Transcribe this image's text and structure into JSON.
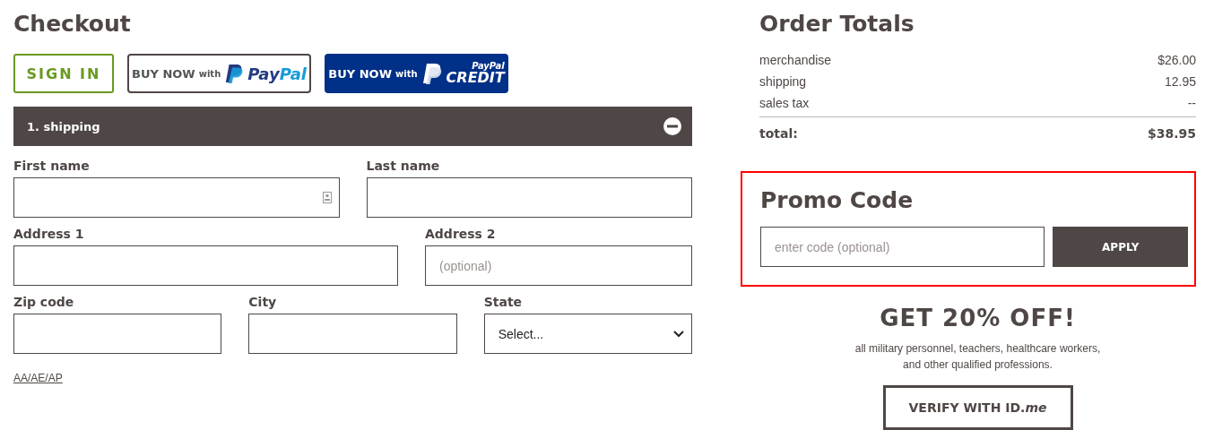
{
  "page_title": "Checkout",
  "sign_in_button": "SIGN IN",
  "paypal_button": {
    "label": "BUY NOW",
    "small": "with",
    "brand_a": "Pay",
    "brand_b": "Pal"
  },
  "paypal_credit_button": {
    "label": "BUY NOW",
    "small": "with",
    "brand": "PayPal",
    "product": "CREDIT"
  },
  "section": {
    "title": "1. shipping",
    "expanded": true
  },
  "form_rows": [
    [
      {
        "label": "First name",
        "kind": "text",
        "contact_icon": true
      },
      {
        "label": "Last name",
        "kind": "text"
      }
    ],
    [
      {
        "label": "Address 1",
        "kind": "text"
      },
      {
        "label": "Address 2",
        "kind": "text",
        "placeholder": "(optional)"
      }
    ],
    [
      {
        "label": "Zip code",
        "kind": "text"
      },
      {
        "label": "City",
        "kind": "text"
      },
      {
        "label": "State",
        "kind": "select",
        "value": "Select..."
      }
    ]
  ],
  "military_link": "AA/AE/AP",
  "order_totals": {
    "title": "Order Totals",
    "lines": [
      {
        "label": "merchandise",
        "value": "$26.00"
      },
      {
        "label": "shipping",
        "value": "12.95"
      },
      {
        "label": "sales tax",
        "value": "--"
      }
    ],
    "total": {
      "label": "total:",
      "value": "$38.95"
    }
  },
  "promo": {
    "title": "Promo Code",
    "placeholder": "enter code (optional)",
    "button": "APPLY",
    "highlighted": true
  },
  "offer": {
    "headline": "GET 20% OFF!",
    "text": "all military personnel, teachers, healthcare workers, and other qualified professions.",
    "button": "VERIFY WITH ID.*me*"
  }
}
